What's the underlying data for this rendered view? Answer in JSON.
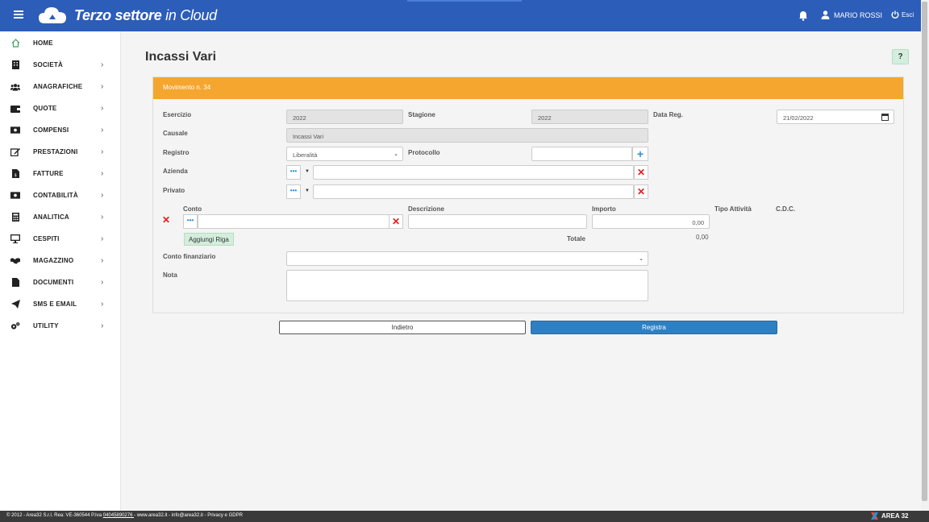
{
  "header": {
    "brand_main": "Terzo settore",
    "brand_suffix": " in Cloud",
    "user_name": "MARIO ROSSI",
    "logout_label": "Esci"
  },
  "sidebar": {
    "items": [
      {
        "label": "HOME",
        "icon": "home-icon"
      },
      {
        "label": "SOCIETÀ",
        "icon": "building-icon"
      },
      {
        "label": "ANAGRAFICHE",
        "icon": "users-icon"
      },
      {
        "label": "QUOTE",
        "icon": "wallet-icon"
      },
      {
        "label": "COMPENSI",
        "icon": "money-icon"
      },
      {
        "label": "PRESTAZIONI",
        "icon": "edit-icon"
      },
      {
        "label": "FATTURE",
        "icon": "invoice-icon"
      },
      {
        "label": "CONTABILITÀ",
        "icon": "money-bill-icon"
      },
      {
        "label": "ANALITICA",
        "icon": "calculator-icon"
      },
      {
        "label": "CESPITI",
        "icon": "monitor-icon"
      },
      {
        "label": "MAGAZZINO",
        "icon": "handshake-icon"
      },
      {
        "label": "DOCUMENTI",
        "icon": "document-icon"
      },
      {
        "label": "SMS E EMAIL",
        "icon": "send-icon"
      },
      {
        "label": "UTILITY",
        "icon": "cogs-icon"
      }
    ]
  },
  "main": {
    "title": "Incassi Vari",
    "help_label": "?",
    "panel_title": "Movimento n. 34",
    "labels": {
      "esercizio": "Esercizio",
      "stagione": "Stagione",
      "data_reg": "Data Reg.",
      "causale": "Causale",
      "registro": "Registro",
      "protocollo": "Protocollo",
      "azienda": "Azienda",
      "privato": "Privato",
      "conto": "Conto",
      "descrizione": "Descrizione",
      "importo": "Importo",
      "tipo_attivita": "Tipo Attività",
      "cdc": "C.D.C.",
      "totale": "Totale",
      "conto_finanziario": "Conto finanziario",
      "nota": "Nota"
    },
    "values": {
      "esercizio": "2022",
      "stagione": "2022",
      "data_reg": "21/02/2022",
      "causale": "Incassi Vari",
      "registro": "Liberalità",
      "importo": "0,00",
      "totale": "0,00"
    },
    "add_row_label": "Aggiungi Riga",
    "back_label": "Indietro",
    "save_label": "Registra"
  },
  "footer": {
    "text_1": "© 2012 - Area32 S.r.l. Rea: VE-360544 P.Iva ",
    "vat": "04045890276 ",
    "text_2": "- www.area32.it - info@area32.it - Privacy e GDPR",
    "brand": "AREA 32"
  },
  "colors": {
    "topbar": "#2c5db8",
    "panel_header": "#f4a62f",
    "primary_button": "#2f7fc1",
    "danger": "#e02020",
    "home_icon": "#3aa35b"
  }
}
